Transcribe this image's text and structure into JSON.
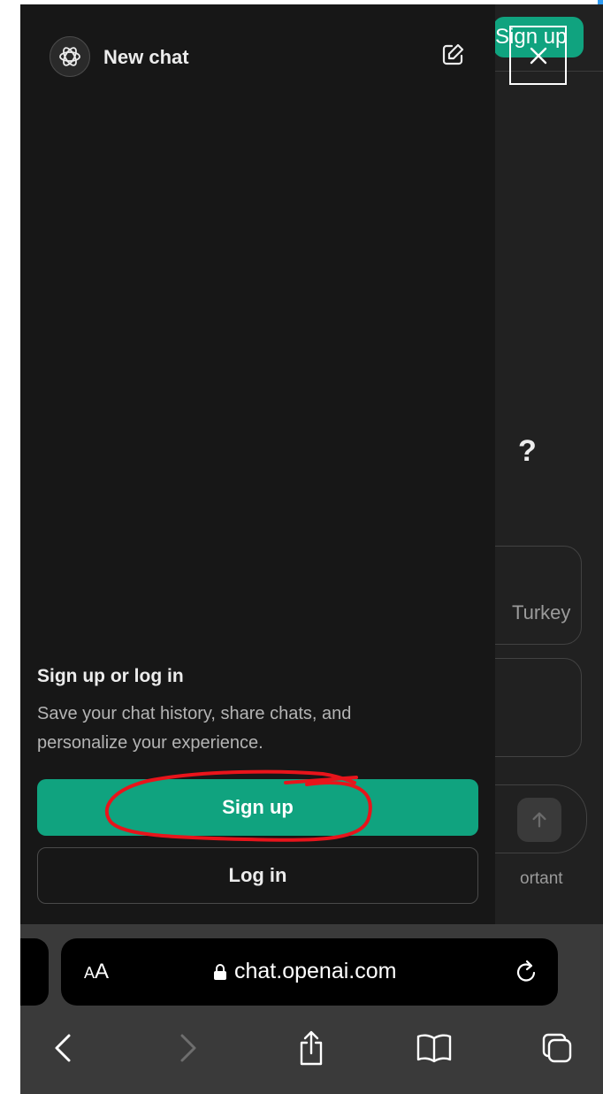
{
  "header": {
    "new_chat_label": "New chat"
  },
  "background_page": {
    "signup_label": "Sign up",
    "question_fragment": "?",
    "card_text_fragment": "Turkey",
    "note_fragment": "ortant"
  },
  "auth": {
    "title": "Sign up or log in",
    "description": "Save your chat history, share chats, and personalize your experience.",
    "signup_label": "Sign up",
    "login_label": "Log in"
  },
  "browser": {
    "text_size_small": "A",
    "text_size_large": "A",
    "url": "chat.openai.com"
  },
  "colors": {
    "accent_green": "#10a37f",
    "annotation_red": "#e8141b",
    "sidebar_bg": "#171717",
    "page_bg": "#212121"
  },
  "icons": [
    "openai-logo-icon",
    "edit-icon",
    "close-icon",
    "send-arrow-icon",
    "lock-icon",
    "reload-icon",
    "back-icon",
    "forward-icon",
    "share-icon",
    "bookmarks-icon",
    "tabs-icon"
  ]
}
